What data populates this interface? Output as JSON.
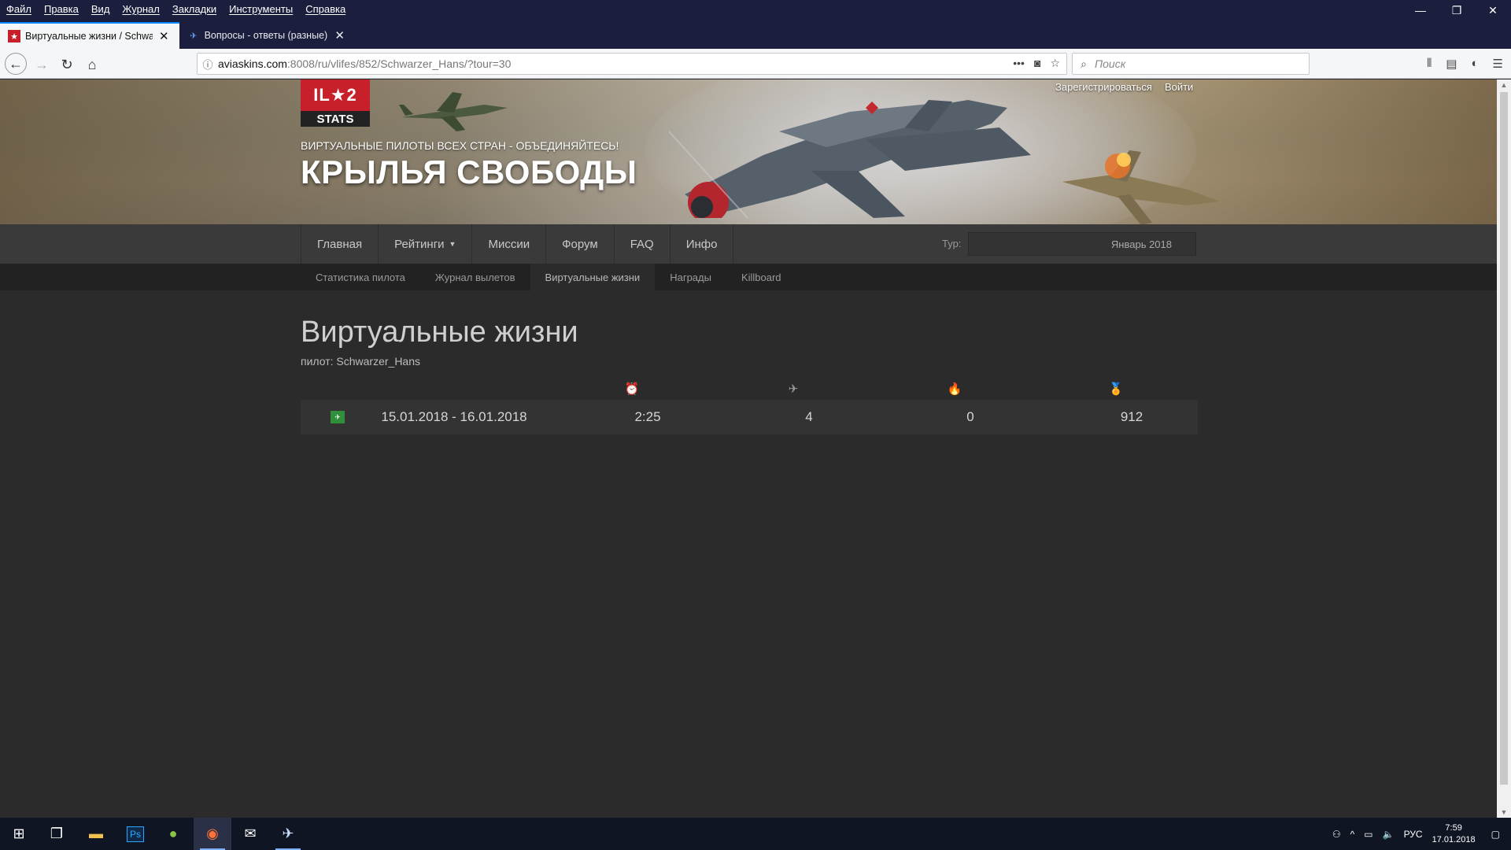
{
  "menubar": {
    "items": [
      "Файл",
      "Правка",
      "Вид",
      "Журнал",
      "Закладки",
      "Инструменты",
      "Справка"
    ]
  },
  "window_controls": {
    "minimize": "—",
    "restore": "❐",
    "close": "✕"
  },
  "tabs": [
    {
      "title": "Виртуальные жизни / Schwarz",
      "favicon": "il2-star-icon",
      "active": true
    },
    {
      "title": "Вопросы - ответы (разные) - С",
      "favicon": "forum-icon",
      "active": false
    }
  ],
  "navbar": {
    "url_host": "aviaskins.com",
    "url_path": ":8008/ru/vlifes/852/Schwarzer_Hans/?tour=30",
    "search_placeholder": "Поиск"
  },
  "site": {
    "logo_top": "IL★2",
    "logo_bottom": "STATS",
    "slogan": "ВИРТУАЛЬНЫЕ ПИЛОТЫ ВСЕХ СТРАН - ОБЪЕДИНЯЙТЕСЬ!",
    "name": "КРЫЛЬЯ СВОБОДЫ",
    "register": "Зарегистрироваться",
    "login": "Войти"
  },
  "mainnav": {
    "items": [
      "Главная",
      "Рейтинги",
      "Миссии",
      "Форум",
      "FAQ",
      "Инфо"
    ],
    "tour_label": "Тур:",
    "tour_value": "Январь 2018"
  },
  "subnav": {
    "items": [
      "Статистика пилота",
      "Журнал вылетов",
      "Виртуальные жизни",
      "Награды",
      "Killboard"
    ],
    "active_index": 2
  },
  "content": {
    "title": "Виртуальные жизни",
    "pilot_line": "пилот: Schwarzer_Hans",
    "columns": [
      "time-icon",
      "aircraft-kills-icon",
      "ground-kills-icon",
      "score-icon"
    ],
    "rows": [
      {
        "period": "15.01.2018 - 16.01.2018",
        "time": "2:25",
        "aircraft": "4",
        "ground": "0",
        "score": "912"
      }
    ]
  },
  "taskbar": {
    "lang": "РУС",
    "time": "7:59",
    "date": "17.01.2018"
  },
  "colors": {
    "page_bg": "#2b2b2b",
    "nav_bg": "#3a3a3a",
    "subnav_bg": "#222222",
    "logo_red": "#c8202a",
    "row_bg": "#333333"
  }
}
